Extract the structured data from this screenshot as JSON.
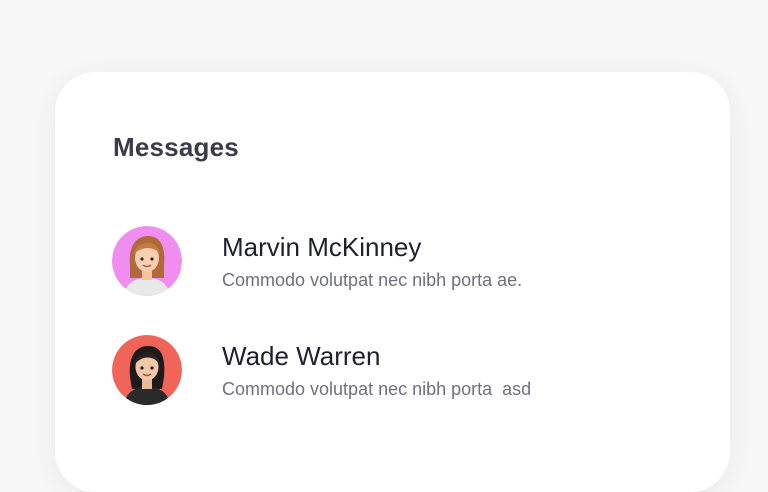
{
  "header": {
    "title": "Messages"
  },
  "messages": [
    {
      "name": "Marvin McKinney",
      "preview": "Commodo volutpat nec nibh porta ae.",
      "avatar_icon": "female-avatar-blonde",
      "avatar_bg": "#f08ef0"
    },
    {
      "name": "Wade Warren",
      "preview": "Commodo volutpat nec nibh porta  asd",
      "avatar_icon": "female-avatar-dark-hair",
      "avatar_bg": "#f0645a"
    }
  ]
}
